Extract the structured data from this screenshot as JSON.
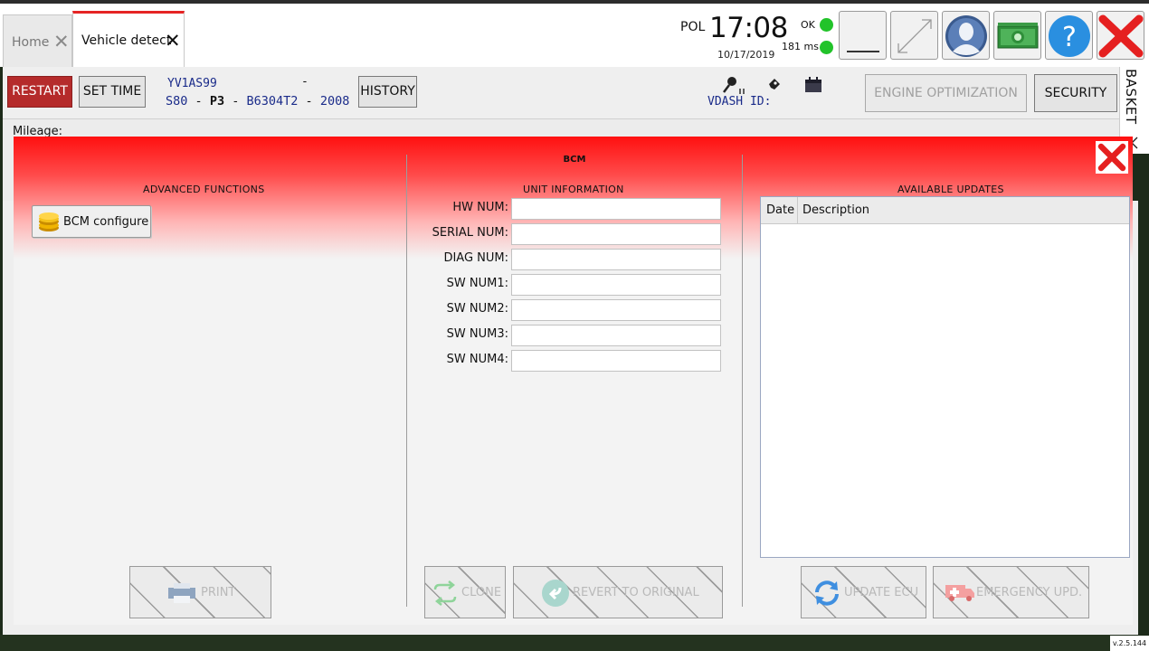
{
  "tabs": [
    {
      "label": "Home",
      "active": false
    },
    {
      "label": "Vehicle detect",
      "active": true
    }
  ],
  "status": {
    "language": "POL",
    "time": "17:08",
    "date": "10/17/2019",
    "connection": "OK",
    "ping": "181 ms",
    "status_color": "#22c32a"
  },
  "window_buttons": [
    "minimize-icon",
    "maximize-icon",
    "user-icon",
    "money-icon",
    "help-icon",
    "close-icon"
  ],
  "vehicle_bar": {
    "restart_label": "RESTART",
    "settime_label": "SET TIME",
    "vin": "YV1AS99",
    "vin_suffix": "-",
    "model": "S80",
    "platform": "P3",
    "engine": "B6304T2",
    "year": "2008",
    "separator": "-",
    "history_label": "HISTORY",
    "vdash_label": "VDASH ID:",
    "engine_opt_label": "ENGINE OPTIMIZATION",
    "security_label": "SECURITY"
  },
  "basket_label": "BASKET",
  "mileage_label": "Mileage:",
  "dialog": {
    "title": "BCM",
    "accent_color": "#ff1010",
    "advanced": {
      "title": "ADVANCED FUNCTIONS",
      "config_button": "BCM configure",
      "print_button": "PRINT"
    },
    "unit_info": {
      "title": "UNIT INFORMATION",
      "fields": [
        {
          "label": "HW NUM:",
          "value": ""
        },
        {
          "label": "SERIAL NUM:",
          "value": ""
        },
        {
          "label": "DIAG NUM:",
          "value": ""
        },
        {
          "label": "SW NUM1:",
          "value": ""
        },
        {
          "label": "SW NUM2:",
          "value": ""
        },
        {
          "label": "SW NUM3:",
          "value": ""
        },
        {
          "label": "SW NUM4:",
          "value": ""
        }
      ],
      "clone_button": "CLONE",
      "revert_button": "REVERT TO ORIGINAL"
    },
    "updates": {
      "title": "AVAILABLE UPDATES",
      "columns": [
        "Date",
        "Description"
      ],
      "rows": [],
      "update_button": "UPDATE ECU",
      "emergency_button": "EMERGENCY UPD."
    }
  },
  "version": "v.2.5.144"
}
